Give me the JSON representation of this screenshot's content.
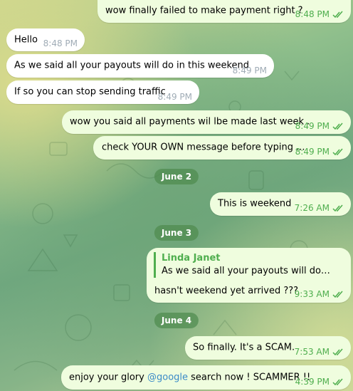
{
  "messages": [
    {
      "text": "wow finally failed to make payment right ?",
      "time": "8:48 PM"
    },
    {
      "text": "Hello",
      "time": "8:48 PM"
    },
    {
      "text": "As we said all your payouts will do in this weekend",
      "time": "8:49 PM"
    },
    {
      "text": "If so you can stop sending traffic",
      "time": "8:49 PM"
    },
    {
      "text": "wow you said all payments wil lbe made last week .",
      "time": "8:49 PM"
    },
    {
      "text": "check YOUR OWN message before typing ...",
      "time": "8:49 PM"
    },
    {
      "text": "This is weekend",
      "time": "7:26 AM"
    },
    {
      "text": "hasn't weekend yet arrived ???",
      "time": "9:33 AM",
      "reply_name": "Linda Janet",
      "reply_text": "As we said all your payouts will do in this weekend"
    },
    {
      "text": "So finally. It's a SCAM.",
      "time": "7:53 AM"
    },
    {
      "text_before": "enjoy your glory ",
      "mention": "@google",
      "text_after": " search now ! SCAMMER !!",
      "time": "4:39 PM"
    }
  ],
  "dates": [
    "June 2",
    "June 3",
    "June 4"
  ],
  "colors": {
    "outgoing_bubble": "#effdde",
    "incoming_bubble": "#ffffff",
    "accent": "#4fae4e",
    "date_pill": "#5a9a5a"
  },
  "icons": {
    "read_status": "double-check-icon"
  }
}
